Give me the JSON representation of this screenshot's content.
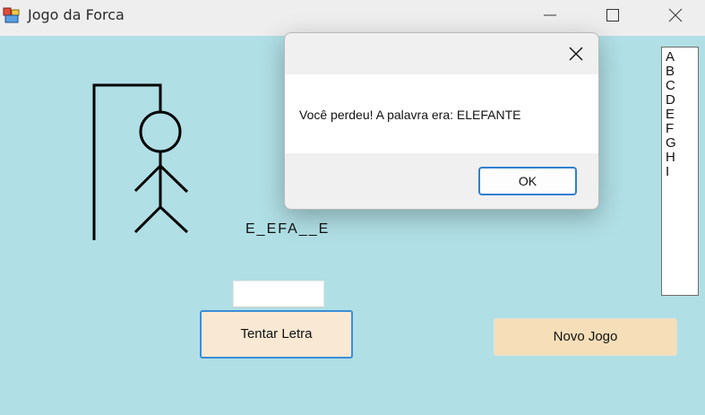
{
  "window": {
    "title": "Jogo da Forca"
  },
  "game": {
    "masked_word": "E_EFA__E",
    "try_button_label": "Tentar Letra",
    "new_game_label": "Novo Jogo",
    "letter_input_value": "",
    "used_letters": [
      "A",
      "B",
      "C",
      "D",
      "E",
      "F",
      "G",
      "H",
      "I"
    ]
  },
  "dialog": {
    "message": "Você perdeu! A palavra era: ELEFANTE",
    "ok_label": "OK"
  },
  "colors": {
    "background": "#b0dfe5",
    "titlebar": "#eeeeee",
    "try_button": "#f9e8d3",
    "new_game_button": "#f5deb8",
    "focus_border": "#2f7fd0"
  }
}
